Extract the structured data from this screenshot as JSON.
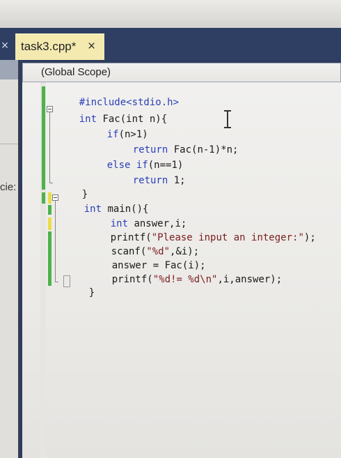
{
  "tabs": {
    "left_close_glyph": "×",
    "active": {
      "label": "task3.cpp*",
      "close_glyph": "×"
    }
  },
  "left_panel": {
    "partial_text": "cie:"
  },
  "scope_bar": {
    "label": "(Global Scope)"
  },
  "code": {
    "line1": "#include<stdio.h>",
    "line2_kw": "int",
    "line2_rest": " Fac(int n){",
    "line3_kw": "if",
    "line3_rest": "(n>1)",
    "line4_kw": "return",
    "line4_rest": " Fac(n-1)*n;",
    "line5_kw": "else if",
    "line5_rest": "(n==1)",
    "line6_kw": "return",
    "line6_rest": " 1;",
    "line7": "}",
    "line8_kw": "int",
    "line8_rest": " main(){",
    "line9_kw": "int",
    "line9_rest": " answer,i;",
    "line10_a": "printf(",
    "line10_str": "\"Please input an integer:\"",
    "line10_b": ");",
    "line11_a": "scanf(",
    "line11_str": "\"%d\"",
    "line11_b": ",&i);",
    "line12": "answer = Fac(i);",
    "line13_a": "printf(",
    "line13_str": "\"%d!= %d\\n\"",
    "line13_b": ",i,answer);",
    "line14": "}"
  },
  "colors": {
    "keyword": "#2a3fb8",
    "string": "#7a1d1d",
    "tab_active_bg": "#f4eab0",
    "frame": "#2e3d5e",
    "change_saved": "#4cb24a",
    "change_unsaved": "#e9dc4c"
  }
}
